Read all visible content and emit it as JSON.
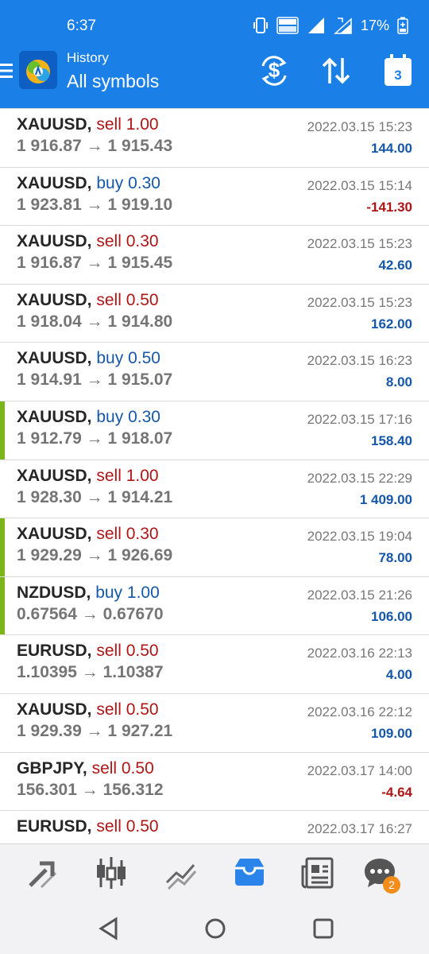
{
  "status_bar": {
    "time": "6:37",
    "battery_percent": "17%",
    "icons": [
      "vibrate-icon",
      "volte-icon",
      "signal-icon",
      "4g-icon",
      "battery-icon"
    ]
  },
  "header": {
    "subtitle": "History",
    "title": "All symbols",
    "calendar_day": "3",
    "actions": [
      "currency-filter-icon",
      "sort-icon",
      "calendar-icon"
    ]
  },
  "trades": [
    {
      "symbol": "XAUUSD,",
      "side": "sell",
      "lot": "1.00",
      "open_price": "1 916.87",
      "close_price": "1 915.43",
      "time": "2022.03.15 15:23",
      "profit": "144.00",
      "profit_sign": "pos",
      "marked": false
    },
    {
      "symbol": "XAUUSD,",
      "side": "buy",
      "lot": "0.30",
      "open_price": "1 923.81",
      "close_price": "1 919.10",
      "time": "2022.03.15 15:14",
      "profit": "-141.30",
      "profit_sign": "neg",
      "marked": false
    },
    {
      "symbol": "XAUUSD,",
      "side": "sell",
      "lot": "0.30",
      "open_price": "1 916.87",
      "close_price": "1 915.45",
      "time": "2022.03.15 15:23",
      "profit": "42.60",
      "profit_sign": "pos",
      "marked": false
    },
    {
      "symbol": "XAUUSD,",
      "side": "sell",
      "lot": "0.50",
      "open_price": "1 918.04",
      "close_price": "1 914.80",
      "time": "2022.03.15 15:23",
      "profit": "162.00",
      "profit_sign": "pos",
      "marked": false
    },
    {
      "symbol": "XAUUSD,",
      "side": "buy",
      "lot": "0.50",
      "open_price": "1 914.91",
      "close_price": "1 915.07",
      "time": "2022.03.15 16:23",
      "profit": "8.00",
      "profit_sign": "pos",
      "marked": false
    },
    {
      "symbol": "XAUUSD,",
      "side": "buy",
      "lot": "0.30",
      "open_price": "1 912.79",
      "close_price": "1 918.07",
      "time": "2022.03.15 17:16",
      "profit": "158.40",
      "profit_sign": "pos",
      "marked": true
    },
    {
      "symbol": "XAUUSD,",
      "side": "sell",
      "lot": "1.00",
      "open_price": "1 928.30",
      "close_price": "1 914.21",
      "time": "2022.03.15 22:29",
      "profit": "1 409.00",
      "profit_sign": "pos",
      "marked": false
    },
    {
      "symbol": "XAUUSD,",
      "side": "sell",
      "lot": "0.30",
      "open_price": "1 929.29",
      "close_price": "1 926.69",
      "time": "2022.03.15 19:04",
      "profit": "78.00",
      "profit_sign": "pos",
      "marked": true
    },
    {
      "symbol": "NZDUSD,",
      "side": "buy",
      "lot": "1.00",
      "open_price": "0.67564",
      "close_price": "0.67670",
      "time": "2022.03.15 21:26",
      "profit": "106.00",
      "profit_sign": "pos",
      "marked": true
    },
    {
      "symbol": "EURUSD,",
      "side": "sell",
      "lot": "0.50",
      "open_price": "1.10395",
      "close_price": "1.10387",
      "time": "2022.03.16 22:13",
      "profit": "4.00",
      "profit_sign": "pos",
      "marked": false
    },
    {
      "symbol": "XAUUSD,",
      "side": "sell",
      "lot": "0.50",
      "open_price": "1 929.39",
      "close_price": "1 927.21",
      "time": "2022.03.16 22:12",
      "profit": "109.00",
      "profit_sign": "pos",
      "marked": false
    },
    {
      "symbol": "GBPJPY,",
      "side": "sell",
      "lot": "0.50",
      "open_price": "156.301",
      "close_price": "156.312",
      "time": "2022.03.17 14:00",
      "profit": "-4.64",
      "profit_sign": "neg",
      "marked": false
    },
    {
      "symbol": "EURUSD,",
      "side": "sell",
      "lot": "0.50",
      "open_price": "",
      "close_price": "",
      "time": "2022.03.17 16:27",
      "profit": "",
      "profit_sign": "pos",
      "marked": false
    }
  ],
  "price_arrow": "→",
  "bottom_nav": {
    "items": [
      "quotes-icon",
      "chart-candles-icon",
      "trade-icon",
      "history-icon",
      "news-icon",
      "chat-icon"
    ],
    "active": "history-icon",
    "chat_badge": "2"
  },
  "system_nav": [
    "back-icon",
    "home-icon",
    "recents-icon"
  ],
  "colors": {
    "header_blue": "#1a7fe6",
    "sell_red": "#b01515",
    "buy_blue": "#1557a8",
    "profit_positive": "#1557a8",
    "profit_negative": "#b01515",
    "marker_green": "#7cb518",
    "badge_orange": "#f28c1a"
  }
}
